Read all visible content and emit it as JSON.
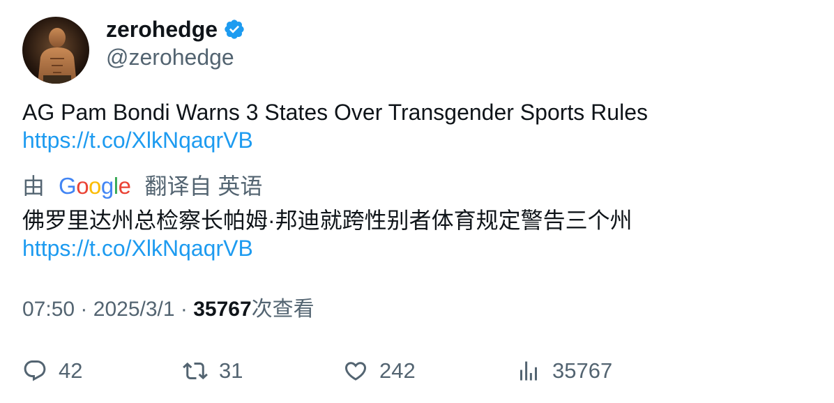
{
  "tweet": {
    "author": {
      "display_name": "zerohedge",
      "handle": "@zerohedge",
      "verified": true,
      "verified_icon": "verified-badge-icon",
      "accent": "#1d9bf0"
    },
    "text": "AG Pam Bondi Warns 3 States Over Transgender Sports Rules",
    "link": "https://t.co/XlkNqaqrVB",
    "translation": {
      "prefix": "由",
      "provider": "Google",
      "suffix": "翻译自 英语",
      "text": "佛罗里达州总检察长帕姆·邦迪就跨性别者体育规定警告三个州",
      "link": "https://t.co/XlkNqaqrVB"
    },
    "meta": {
      "time": "07:50",
      "separator": "·",
      "date": "2025/3/1",
      "views_count": "35767",
      "views_label": "次查看"
    },
    "actions": {
      "replies": "42",
      "retweets": "31",
      "likes": "242",
      "views": "35767"
    }
  }
}
